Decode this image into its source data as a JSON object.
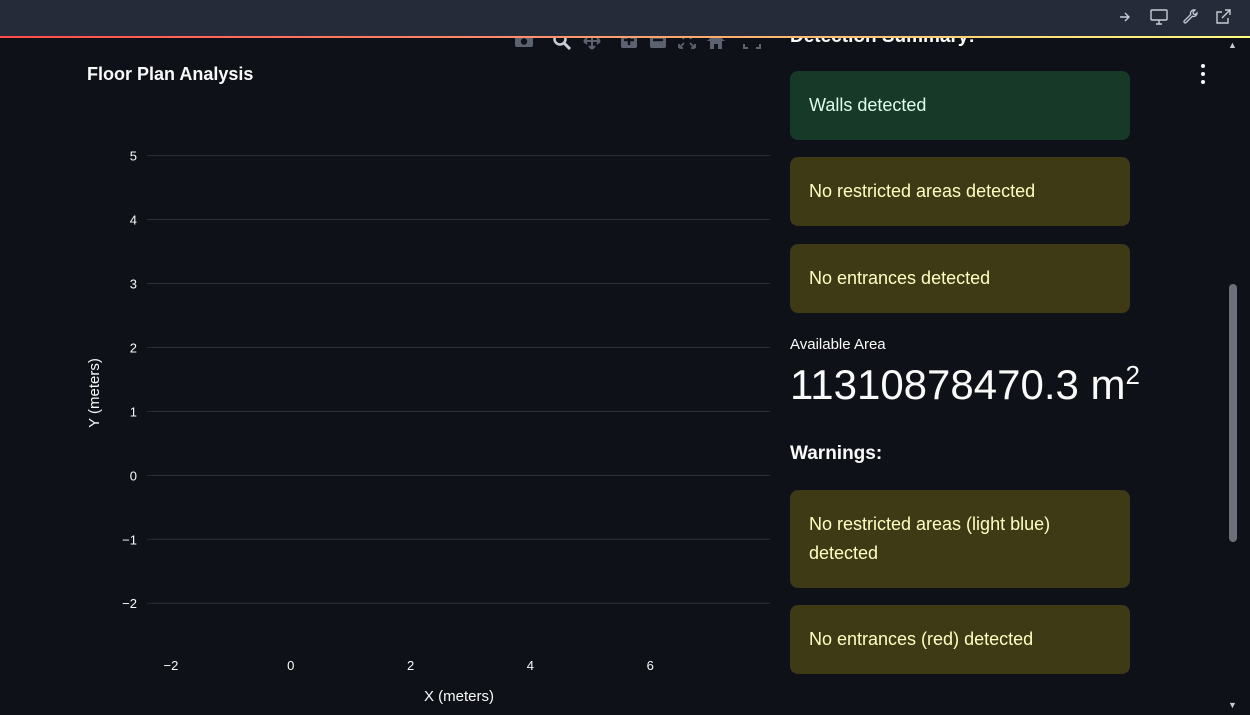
{
  "toolbar_icons": [
    "arrow-right-icon",
    "monitor-icon",
    "wrench-icon",
    "external-link-icon"
  ],
  "modebar_icons": [
    "camera-icon",
    "zoom-icon",
    "pan-icon",
    "zoom-in-icon",
    "zoom-out-icon",
    "autoscale-icon",
    "home-icon",
    "fullscreen-icon"
  ],
  "chart": {
    "title": "Floor Plan Analysis"
  },
  "chart_data": {
    "type": "scatter",
    "title": "Floor Plan Analysis",
    "xlabel": "X (meters)",
    "ylabel": "Y (meters)",
    "x_ticks": [
      "−2",
      "0",
      "2",
      "4",
      "6"
    ],
    "y_ticks": [
      "5",
      "4",
      "3",
      "2",
      "1",
      "0",
      "−1",
      "−2"
    ],
    "xlim": [
      -2.4,
      8.0
    ],
    "ylim": [
      -2.7,
      5.4
    ],
    "grid": true,
    "series": []
  },
  "detection": {
    "heading": "Detection Summary:",
    "alerts": [
      {
        "kind": "success",
        "text": "Walls detected"
      },
      {
        "kind": "warning",
        "text": "No restricted areas detected"
      },
      {
        "kind": "warning",
        "text": "No entrances detected"
      }
    ]
  },
  "metric": {
    "label": "Available Area",
    "value": "11310878470.3 m",
    "unit_sup": "2"
  },
  "warnings": {
    "heading": "Warnings:",
    "items": [
      {
        "kind": "warning",
        "text": "No restricted areas (light blue) detected"
      },
      {
        "kind": "warning",
        "text": "No entrances (red) detected"
      }
    ]
  },
  "colors": {
    "background": "#0e1117",
    "topbar": "#262b3a",
    "success_bg": "#173928",
    "warning_bg": "#3e3a16",
    "grid": "#2b2f38"
  }
}
